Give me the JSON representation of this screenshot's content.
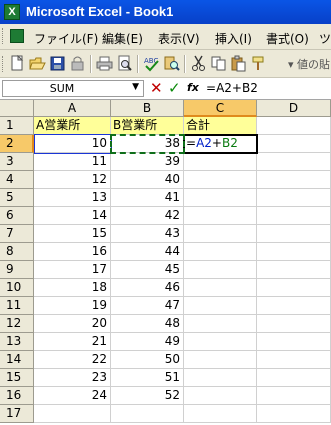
{
  "window": {
    "title": "Microsoft Excel - Book1",
    "app_icon_letter": "X"
  },
  "menu": [
    "ファイル(F)",
    "編集(E)",
    "表示(V)",
    "挿入(I)",
    "書式(O)",
    "ツ"
  ],
  "toolbar": {
    "icons": [
      "new-icon",
      "open-icon",
      "save-icon",
      "permission-icon",
      "print-icon",
      "print-preview-icon",
      "spelling-icon",
      "research-icon",
      "cut-icon",
      "copy-icon",
      "paste-icon"
    ],
    "overflow_text": "▾ 値の貼"
  },
  "formula_bar": {
    "name_box": "SUM",
    "fx_label": "fx",
    "parts": {
      "eq": "=",
      "a_ref": "A2",
      "plus": "+",
      "b_ref": "B2"
    }
  },
  "columns": [
    "A",
    "B",
    "C",
    "D"
  ],
  "rows": [
    "1",
    "2",
    "3",
    "4",
    "5",
    "6",
    "7",
    "8",
    "9",
    "10",
    "11",
    "12",
    "13",
    "14",
    "15",
    "16",
    "17"
  ],
  "headers": {
    "a": "A営業所",
    "b": "B営業所",
    "c": "合計"
  },
  "data": [
    {
      "a": "10",
      "b": "38"
    },
    {
      "a": "11",
      "b": "39"
    },
    {
      "a": "12",
      "b": "40"
    },
    {
      "a": "13",
      "b": "41"
    },
    {
      "a": "14",
      "b": "42"
    },
    {
      "a": "15",
      "b": "43"
    },
    {
      "a": "16",
      "b": "44"
    },
    {
      "a": "17",
      "b": "45"
    },
    {
      "a": "18",
      "b": "46"
    },
    {
      "a": "19",
      "b": "47"
    },
    {
      "a": "20",
      "b": "48"
    },
    {
      "a": "21",
      "b": "49"
    },
    {
      "a": "22",
      "b": "50"
    },
    {
      "a": "23",
      "b": "51"
    },
    {
      "a": "24",
      "b": "52"
    }
  ],
  "editing_cell": {
    "eq": "=",
    "a_ref": "A2",
    "plus": "+",
    "b_ref": "B2"
  },
  "colors": {
    "header_fill": "#ffff99",
    "ref_a": "#0020c8",
    "ref_b": "#0a7a10",
    "active_header": "#f7c969"
  }
}
